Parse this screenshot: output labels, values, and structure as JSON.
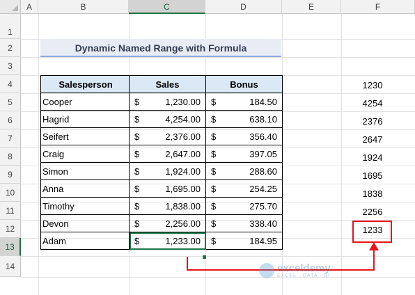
{
  "columns": [
    "A",
    "B",
    "C",
    "D",
    "E",
    "F"
  ],
  "rows": [
    "1",
    "2",
    "3",
    "4",
    "5",
    "6",
    "7",
    "8",
    "9",
    "10",
    "11",
    "12",
    "13",
    "14"
  ],
  "title": "Dynamic Named Range with Formula",
  "headers": {
    "salesperson": "Salesperson",
    "sales": "Sales",
    "bonus": "Bonus"
  },
  "currency": "$",
  "records": [
    {
      "name": "Cooper",
      "sales": "1,230.00",
      "bonus": "184.50"
    },
    {
      "name": "Hagrid",
      "sales": "4,254.00",
      "bonus": "638.10"
    },
    {
      "name": "Seifert",
      "sales": "2,376.00",
      "bonus": "356.40"
    },
    {
      "name": "Craig",
      "sales": "2,647.00",
      "bonus": "397.05"
    },
    {
      "name": "Simon",
      "sales": "1,924.00",
      "bonus": "288.60"
    },
    {
      "name": "Anna",
      "sales": "1,695.00",
      "bonus": "254.25"
    },
    {
      "name": "Timothy",
      "sales": "1,838.00",
      "bonus": "275.70"
    },
    {
      "name": "Devon",
      "sales": "2,256.00",
      "bonus": "338.40"
    },
    {
      "name": "Adam",
      "sales": "1,233.00",
      "bonus": "184.95"
    }
  ],
  "column_f": [
    "1230",
    "4254",
    "2376",
    "2647",
    "1924",
    "1695",
    "1838",
    "2256",
    "1233"
  ],
  "watermark": {
    "main": "exceldemy",
    "sub": "EXCEL · DATA · BI"
  },
  "colors": {
    "accent": "#217346",
    "highlight": "#e8141b",
    "header_fill": "#dbe9f7"
  }
}
